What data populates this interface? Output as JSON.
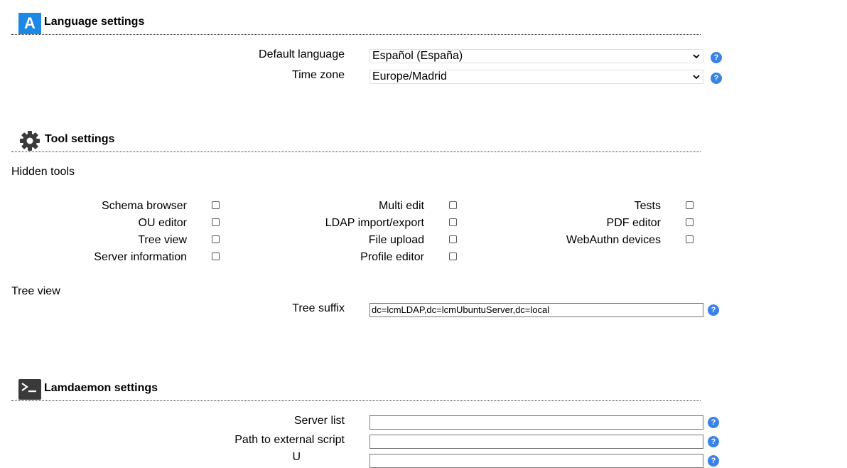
{
  "language_section": {
    "title": "Language settings",
    "icon": "language-icon",
    "icon_letter": "A",
    "accent": "#1e88e5",
    "default_language_label": "Default language",
    "default_language_value": "Español (España)",
    "time_zone_label": "Time zone",
    "time_zone_value": "Europe/Madrid"
  },
  "tool_section": {
    "title": "Tool settings",
    "icon": "gear-icon",
    "hidden_tools_label": "Hidden tools",
    "tools_col1": [
      "Schema browser",
      "OU editor",
      "Tree view",
      "Server information"
    ],
    "tools_col2": [
      "Multi edit",
      "LDAP import/export",
      "File upload",
      "Profile editor"
    ],
    "tools_col3": [
      "Tests",
      "PDF editor",
      "WebAuthn devices"
    ],
    "tree_view_heading": "Tree view",
    "tree_suffix_label": "Tree suffix",
    "tree_suffix_value": "dc=lcmLDAP,dc=lcmUbuntuServer,dc=local"
  },
  "lamdaemon_section": {
    "title": "Lamdaemon settings",
    "icon": "terminal-icon",
    "server_list_label": "Server list",
    "server_list_value": "",
    "path_script_label": "Path to external script",
    "path_script_value": "",
    "third_label_partial": "U"
  },
  "help_glyph": "?"
}
